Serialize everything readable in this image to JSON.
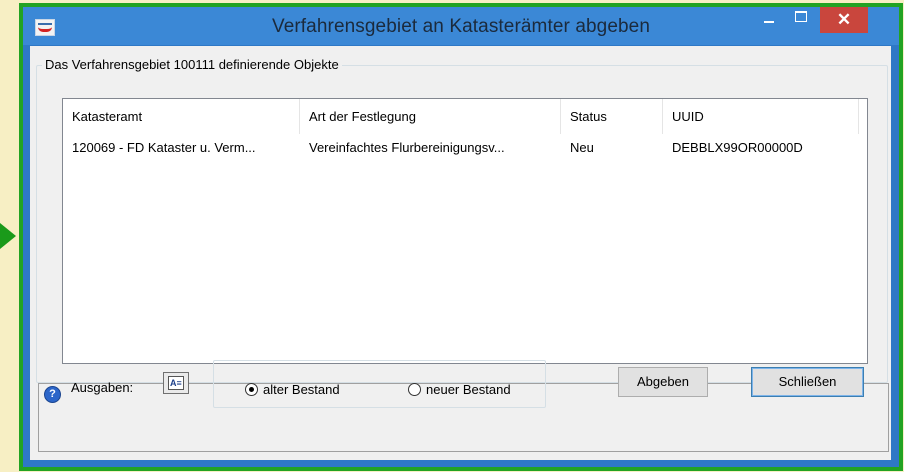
{
  "window": {
    "title": "Verfahrensgebiet an Katasterämter abgeben",
    "close_glyph": "✕"
  },
  "group": {
    "legend": "Das Verfahrensgebiet 100111 definierende Objekte"
  },
  "table": {
    "columns": [
      "Katasteramt",
      "Art der Festlegung",
      "Status",
      "UUID"
    ],
    "rows": [
      [
        "120069 - FD Kataster u. Verm...",
        "Vereinfachtes Flurbereinigungsv...",
        "Neu",
        "DEBBLX99OR00000D"
      ]
    ]
  },
  "footer": {
    "help_glyph": "?",
    "ausgaben_label": "Ausgaben:",
    "ausgaben_button_glyph": "A≡",
    "radio_options": [
      "alter Bestand",
      "neuer Bestand"
    ],
    "selected_radio": "alter Bestand",
    "submit_label": "Abgeben",
    "close_label": "Schließen"
  },
  "colors": {
    "accent_border": "#22a322",
    "titlebar": "#3b88d6",
    "close_button": "#c9463d",
    "background": "#f7efc4"
  },
  "icons": {
    "window": "app-logo-icon",
    "minimize": "minimize-icon",
    "maximize": "maximize-icon",
    "close": "close-icon",
    "help": "help-icon",
    "ausgaben": "text-format-icon",
    "pointer": "green-arrow-icon"
  }
}
